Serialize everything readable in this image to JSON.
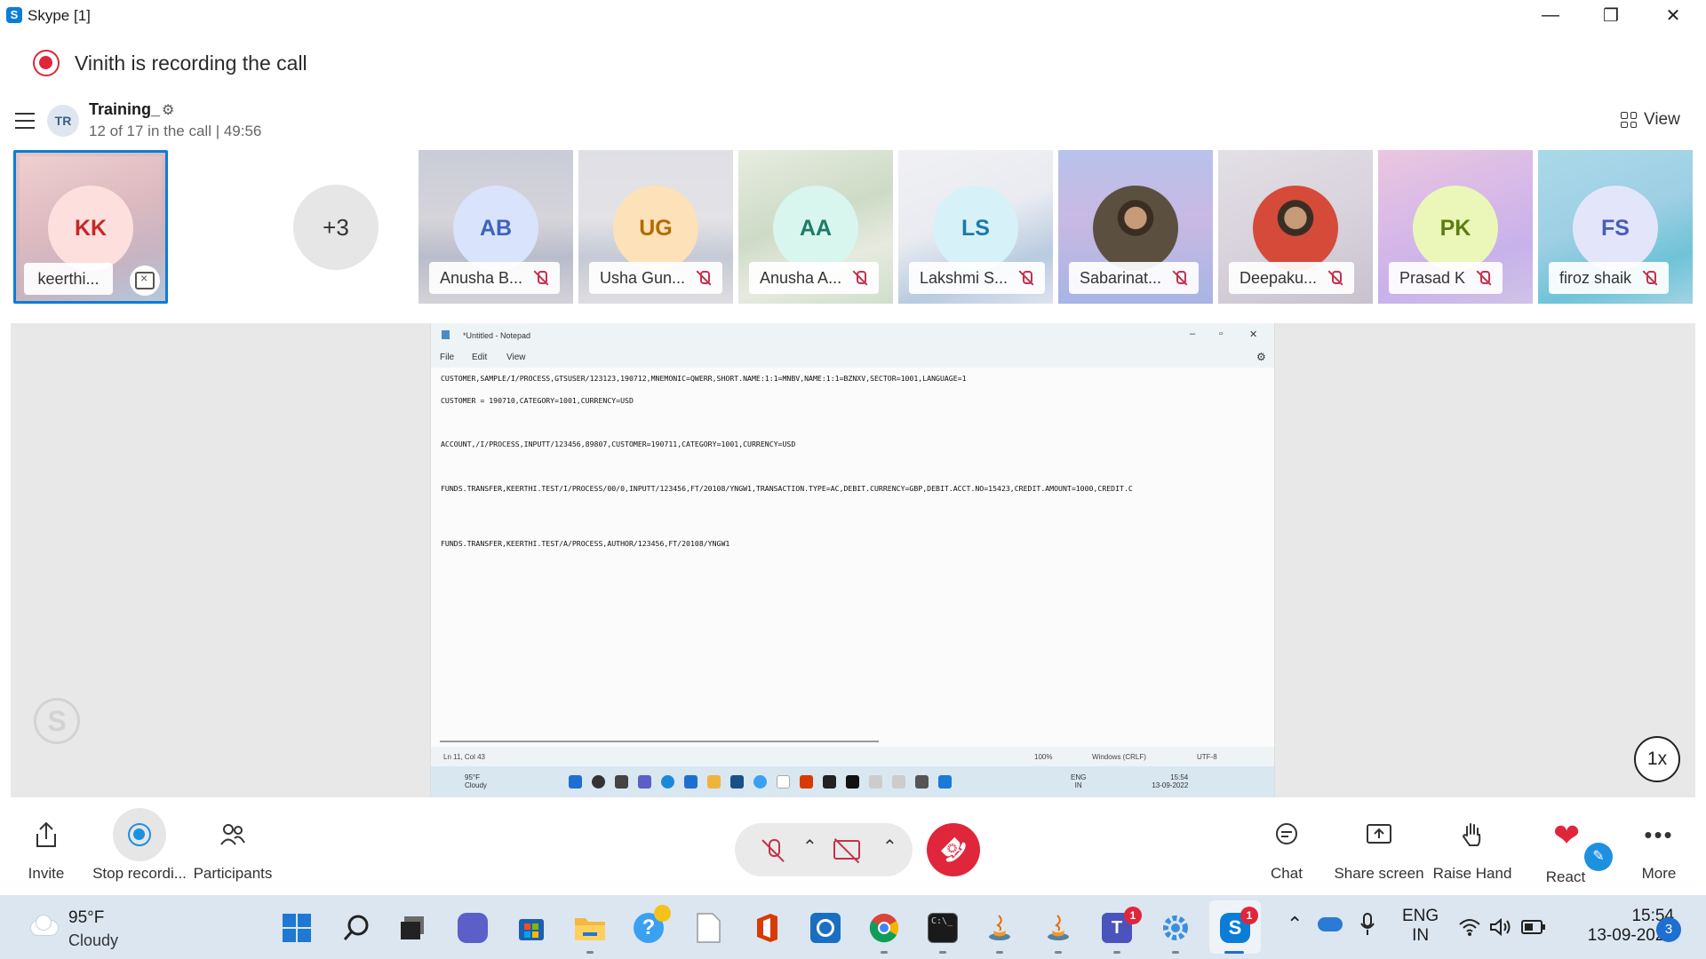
{
  "window": {
    "title": "Skype [1]",
    "app_logo": "S",
    "controls": {
      "minimize": "—",
      "restore": "❐",
      "close": "✕"
    }
  },
  "recording_banner": {
    "text": "Vinith is recording the call"
  },
  "call_header": {
    "avatar_initials": "TR",
    "title": "Training_",
    "subtitle": "12 of 17 in the call | 49:56",
    "view_label": "View"
  },
  "self_tile": {
    "initials": "KK",
    "name": "keerthi...",
    "initials_color": "#c62828"
  },
  "overflow_count": "+3",
  "participants": [
    {
      "initials": "AB",
      "name": "Anusha B...",
      "avatar_color": "#d9e3fb",
      "text_color": "#3f63b8"
    },
    {
      "initials": "UG",
      "name": "Usha Gun...",
      "avatar_color": "#fde1b8",
      "text_color": "#b36b00"
    },
    {
      "initials": "AA",
      "name": "Anusha A...",
      "avatar_color": "#d8f5ee",
      "text_color": "#1f7a66"
    },
    {
      "initials": "LS",
      "name": "Lakshmi S...",
      "avatar_color": "#d7f1f9",
      "text_color": "#1d79a8"
    },
    {
      "initials": "",
      "name": "Sabarinat...",
      "avatar_color": "#5b5040",
      "text_color": "#ffffff",
      "photo": true
    },
    {
      "initials": "",
      "name": "Deepaku...",
      "avatar_color": "#d64a3a",
      "text_color": "#ffffff",
      "photo": true
    },
    {
      "initials": "PK",
      "name": "Prasad K",
      "avatar_color": "#eaf7b9",
      "text_color": "#5d7d10"
    },
    {
      "initials": "FS",
      "name": "firoz shaik",
      "avatar_color": "#e3e6fb",
      "text_color": "#4a5bb8"
    }
  ],
  "shared_screen": {
    "notepad_title": "*Untitled - Notepad",
    "menu": [
      "File",
      "Edit",
      "View"
    ],
    "lines": [
      "CUSTOMER,SAMPLE/I/PROCESS,GTSUSER/123123,190712,MNEMONIC=QWERR,SHORT.NAME:1:1=MNBV,NAME:1:1=BZNXV,SECTOR=1001,LANGUAGE=1",
      "CUSTOMER = 190710,CATEGORY=1001,CURRENCY=USD",
      "ACCOUNT,/I/PROCESS,INPUTT/123456,89807,CUSTOMER=190711,CATEGORY=1001,CURRENCY=USD",
      "FUNDS.TRANSFER,KEERTHI.TEST/I/PROCESS/00/0,INPUTT/123456,FT/20108/YNGW1,TRANSACTION.TYPE=AC,DEBIT.CURRENCY=GBP,DEBIT.ACCT.NO=15423,CREDIT.AMOUNT=1000,CREDIT.C",
      "FUNDS.TRANSFER,KEERTHI.TEST/A/PROCESS,AUTHOR/123456,FT/20108/YNGW1"
    ],
    "status": {
      "position": "Ln 11, Col 43",
      "zoom": "100%",
      "line_ending": "Windows (CRLF)",
      "encoding": "UTF-8"
    },
    "taskbar": {
      "temp": "95°F",
      "condition": "Cloudy",
      "lang_top": "ENG",
      "lang_bottom": "IN",
      "time": "15:54",
      "date": "13-09-2022"
    }
  },
  "speed_label": "1x",
  "controls": {
    "invite": "Invite",
    "stop_recording": "Stop recordi...",
    "participants": "Participants",
    "chat": "Chat",
    "share_screen": "Share screen",
    "raise_hand": "Raise Hand",
    "react": "React",
    "more": "More"
  },
  "taskbar": {
    "temp": "95°F",
    "condition": "Cloudy",
    "lang_top": "ENG",
    "lang_bottom": "IN",
    "time": "15:54",
    "date": "13-09-2022",
    "notification_count": "3",
    "teams_badge": "1",
    "skype_badge": "1"
  },
  "colors": {
    "accent_blue": "#0a7dd6",
    "record_red": "#e0263b",
    "mute_red": "#c4314b"
  }
}
